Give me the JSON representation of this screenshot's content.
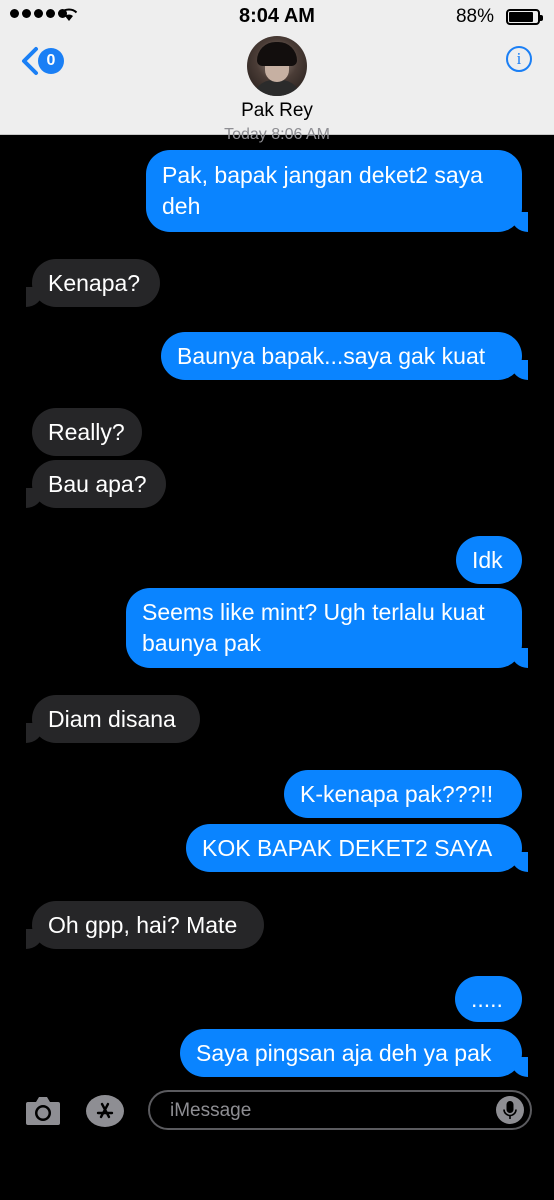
{
  "status_bar": {
    "time": "8:04 AM",
    "battery": "88%"
  },
  "header": {
    "back_badge": "0",
    "contact_name": "Pak Rey",
    "info_label": "i"
  },
  "thread": {
    "timestamp": "Today 8:06 AM",
    "messages": [
      {
        "from": "me",
        "text": "Pak, bapak jangan deket2 saya deh"
      },
      {
        "from": "them",
        "text": "Kenapa?"
      },
      {
        "from": "me",
        "text": "Baunya bapak...saya gak kuat"
      },
      {
        "from": "them",
        "text": "Really?"
      },
      {
        "from": "them",
        "text": "Bau apa?"
      },
      {
        "from": "me",
        "text": "Idk"
      },
      {
        "from": "me",
        "text": "Seems like mint? Ugh terlalu kuat baunya pak"
      },
      {
        "from": "them",
        "text": "Diam disana"
      },
      {
        "from": "me",
        "text": "K-kenapa pak???!!"
      },
      {
        "from": "me",
        "text": "KOK BAPAK DEKET2 SAYA"
      },
      {
        "from": "them",
        "text": "Oh gpp, hai? Mate"
      },
      {
        "from": "me",
        "text": "....."
      },
      {
        "from": "me",
        "text": "Saya pingsan aja deh ya pak"
      }
    ]
  },
  "composer": {
    "placeholder": "iMessage"
  },
  "colors": {
    "sent_bubble": "#0a84ff",
    "received_bubble": "#262628",
    "accent": "#1a7ff5",
    "background": "#000000"
  },
  "icons": [
    "cellular-signal-icon",
    "wifi-icon",
    "battery-icon",
    "back-chevron-icon",
    "info-icon",
    "camera-icon",
    "app-store-icon",
    "microphone-icon"
  ]
}
